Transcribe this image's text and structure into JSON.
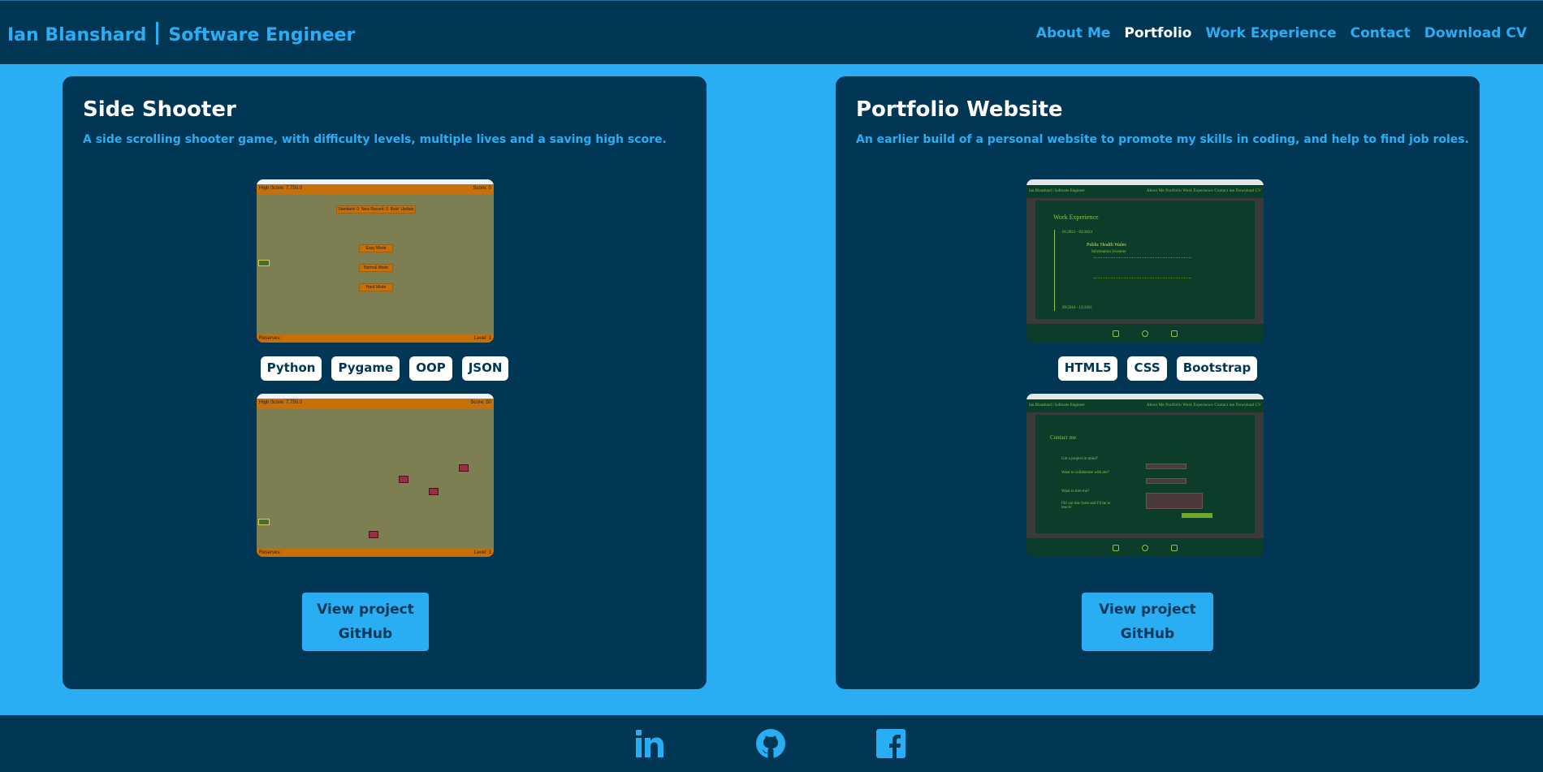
{
  "header": {
    "name": "Ian Blanshard",
    "role": "Software Engineer",
    "nav": [
      {
        "label": "About Me",
        "active": false
      },
      {
        "label": "Portfolio",
        "active": true
      },
      {
        "label": "Work Experience",
        "active": false
      },
      {
        "label": "Contact",
        "active": false
      },
      {
        "label": "Download CV",
        "active": false
      }
    ]
  },
  "projects": [
    {
      "title": "Side Shooter",
      "description": "A side scrolling shooter game, with difficulty levels, multiple lives and a saving high score.",
      "tags": [
        "Python",
        "Pygame",
        "OOP",
        "JSON"
      ],
      "button": {
        "line1": "View project",
        "line2": "GitHub"
      },
      "screenshot1": {
        "high_score": "High Score: 7,750.0",
        "score": "Score: 0",
        "top_options": [
          "Standard: 0",
          "New Record: 0",
          "Best: Update"
        ],
        "modes": [
          "Easy Mode",
          "Normal Mode",
          "Hard Mode"
        ],
        "reserves": "Reserves:",
        "level": "Level: 1"
      },
      "screenshot2": {
        "high_score": "High Score: 7,750.0",
        "score": "Score: 50",
        "reserves": "Reserves:",
        "level": "Level: 1"
      }
    },
    {
      "title": "Portfolio Website",
      "description": "An earlier build of a personal website to promote my skills in coding, and help to find job roles.",
      "tags": [
        "HTML5",
        "CSS",
        "Bootstrap"
      ],
      "button": {
        "line1": "View project",
        "line2": "GitHub"
      },
      "screenshot1": {
        "site_title": "Ian Blanshard | Software Engineer",
        "site_links": "About Me   Portfolio   Work Experience   Contact me   Download CV",
        "heading": "Work Experience",
        "date1": "01/2021 - 03/2024",
        "employer": "Public Health Wales",
        "job_title": "Information Scientist",
        "date2": "09/2016 - 12/2021"
      },
      "screenshot2": {
        "site_title": "Ian Blanshard | Software Engineer",
        "site_links": "About Me   Portfolio   Work Experience   Contact me   Download CV",
        "heading": "Contact me",
        "q1": "Got a project in mind?",
        "q2": "Want to collaborate with me?",
        "q3": "Want to hire me?",
        "q4": "Fill out this form and I'll be in touch!"
      }
    }
  ],
  "footer": {
    "icons": [
      "linkedin-icon",
      "github-icon",
      "facebook-icon"
    ]
  },
  "colors": {
    "navy": "#013655",
    "sky": "#29adf3",
    "white": "#ffffff"
  }
}
